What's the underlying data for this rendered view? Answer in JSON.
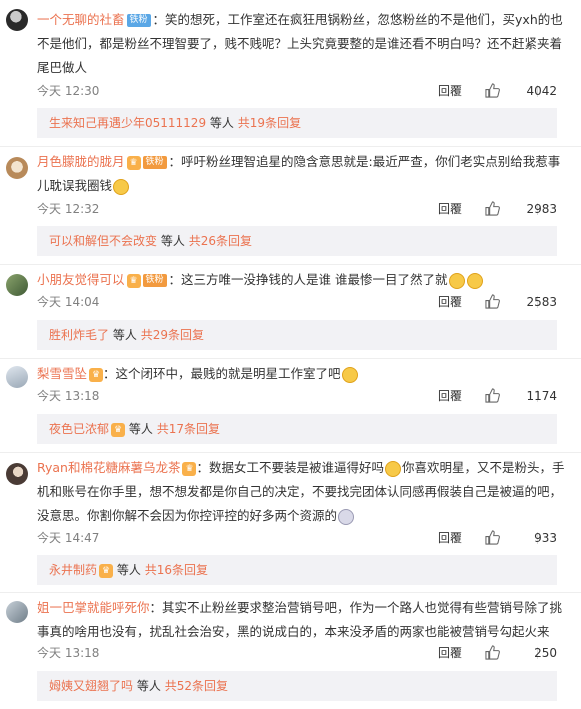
{
  "labels": {
    "reply": "回覆",
    "others": "等人",
    "total_prefix": "共",
    "total_suffix": "条回复"
  },
  "badges": {
    "iron_fan": "铁粉"
  },
  "comments": [
    {
      "user": "一个无聊的社畜",
      "badge": "铁粉",
      "text": "：笑的想死，工作室还在疯狂甩锅粉丝，忽悠粉丝的不是他们，买yxh的也不是他们，都是粉丝不理智要了，贱不贱呢？上头究竟要整的是谁还看不明白吗？还不赶紧夹着尾巴做人",
      "time": "今天 12:30",
      "likes": "4042",
      "sub": {
        "name": "生来知己再遇少年05111129",
        "total": "19"
      }
    },
    {
      "user": "月色朦胧的胧月",
      "badge": "铁粉",
      "text": "：呼吁粉丝理智追星的隐含意思就是:最近严查，你们老实点别给我惹事儿耽误我圈钱",
      "time": "今天 12:32",
      "likes": "2983",
      "sub": {
        "name": "可以和解但不会改变",
        "total": "26"
      }
    },
    {
      "user": "小朋友觉得可以",
      "badge": "铁粉",
      "text": "：这三方唯一没挣钱的人是谁 谁最惨一目了然了就",
      "time": "今天 14:04",
      "likes": "2583",
      "sub": {
        "name": "胜利炸毛了",
        "total": "29"
      }
    },
    {
      "user": "梨雪雪坠",
      "text": "：这个闭环中，最贱的就是明星工作室了吧",
      "time": "今天 13:18",
      "likes": "1174",
      "sub": {
        "name": "夜色已浓郁",
        "total": "17"
      }
    },
    {
      "user": "Ryan和棉花糖麻薯乌龙茶",
      "text_a": "：数据女工不要装是被谁逼得好吗",
      "text_b": "你喜欢明星，又不是粉头，手机和账号在你手里，想不想发都是你自己的决定，不要找完团体认同感再假装自己是被逼的吧，没意思。你割你解不会因为你控评控的好多两个资源的",
      "time": "今天 14:47",
      "likes": "933",
      "sub": {
        "name": "永井制药",
        "total": "16"
      }
    },
    {
      "user": "姐一巴掌就能呼死你",
      "text": "：其实不止粉丝要求整治营销号吧，作为一个路人也觉得有些营销号除了挑事真的啥用也没有，扰乱社会治安，黑的说成白的，本来没矛盾的两家也能被营销号勾起火来",
      "time": "今天 13:18",
      "likes": "250",
      "sub": {
        "name": "姆姨又翅翘了吗",
        "total": "52"
      }
    }
  ],
  "colors": {
    "accent": "#eb7350",
    "meta": "#808080",
    "subbox": "#f2f2f5"
  }
}
